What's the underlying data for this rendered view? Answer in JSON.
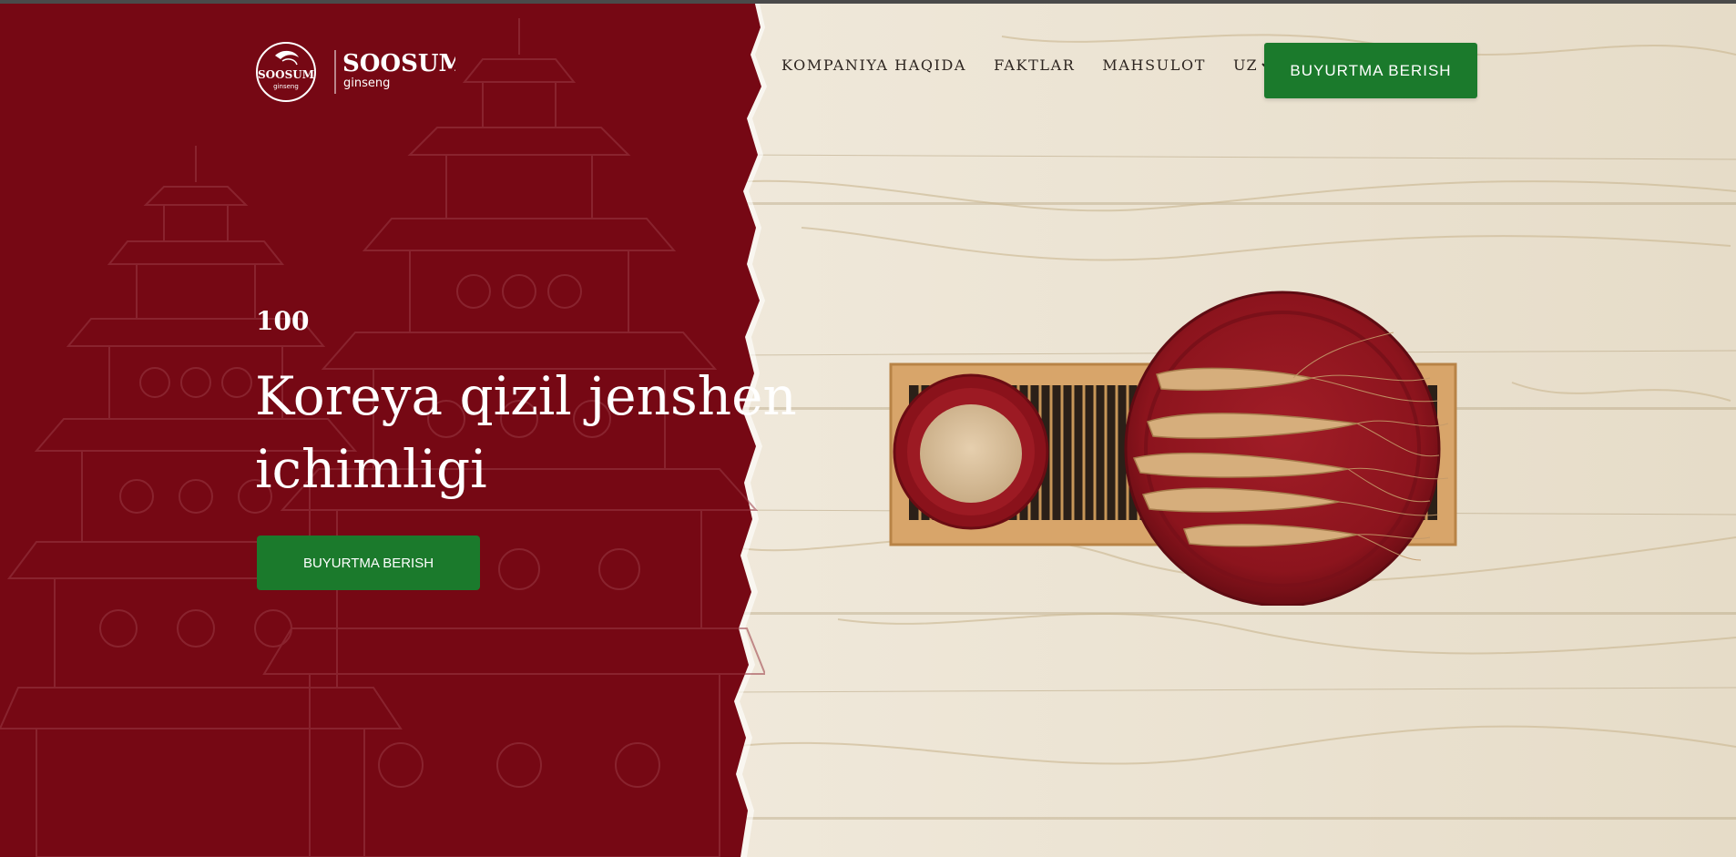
{
  "brand": {
    "emblem_text": "SOOSUM",
    "emblem_sub": "ginseng",
    "wordmark": "SOOSUM",
    "wordmark_sub": "ginseng"
  },
  "nav": {
    "items": [
      {
        "label": "KOMPANIYA HAQIDA"
      },
      {
        "label": "FAKTLAR"
      },
      {
        "label": "MAHSULOT"
      }
    ],
    "language": "UZ",
    "cta_label": "BUYURTMA BERISH"
  },
  "hero": {
    "kicker": "100",
    "headline_line1": "Koreya qizil jenshen",
    "headline_line2": "ichimligi",
    "cta_label": "BUYURTMA BERISH"
  },
  "colors": {
    "brand_red": "#760814",
    "button_green": "#1b7a2c",
    "wood": "#ece3d2"
  },
  "icons": {
    "language_dropdown": "chevron-down-icon"
  }
}
